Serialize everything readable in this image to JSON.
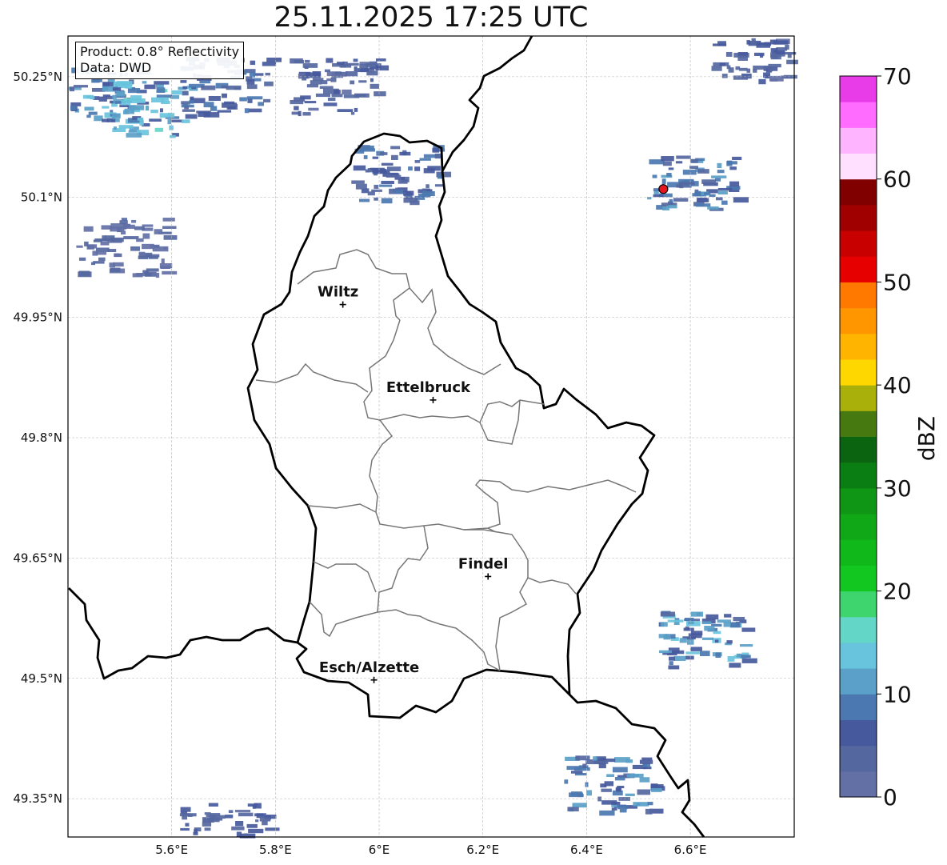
{
  "title": "25.11.2025 17:25 UTC",
  "info": {
    "product": "Product: 0.8° Reflectivity",
    "data": "Data: DWD"
  },
  "axes": {
    "lon_range": [
      5.4,
      6.8
    ],
    "lat_range": [
      49.3,
      50.3
    ],
    "x_ticks": [
      {
        "lon": 5.6,
        "label": "5.6°E"
      },
      {
        "lon": 5.8,
        "label": "5.8°E"
      },
      {
        "lon": 6.0,
        "label": "6°E"
      },
      {
        "lon": 6.2,
        "label": "6.2°E"
      },
      {
        "lon": 6.4,
        "label": "6.4°E"
      },
      {
        "lon": 6.6,
        "label": "6.6°E"
      }
    ],
    "y_ticks": [
      {
        "lat": 50.25,
        "label": "50.25°N"
      },
      {
        "lat": 50.1,
        "label": "50.1°N"
      },
      {
        "lat": 49.95,
        "label": "49.95°N"
      },
      {
        "lat": 49.8,
        "label": "49.8°N"
      },
      {
        "lat": 49.65,
        "label": "49.65°N"
      },
      {
        "lat": 49.5,
        "label": "49.5°N"
      },
      {
        "lat": 49.35,
        "label": "49.35°N"
      }
    ],
    "grid": true
  },
  "cities": [
    {
      "name": "Wiltz",
      "lon": 5.93,
      "lat": 49.966
    },
    {
      "name": "Ettelbruck",
      "lon": 6.104,
      "lat": 49.847
    },
    {
      "name": "Findel",
      "lon": 6.21,
      "lat": 49.627
    },
    {
      "name": "Esch/Alzette",
      "lon": 5.99,
      "lat": 49.498
    }
  ],
  "radar_site": {
    "lon": 6.548,
    "lat": 50.11,
    "color": "#e8141e"
  },
  "colorbar": {
    "label": "dBZ",
    "min": 0,
    "max": 70,
    "step": 2.5,
    "ticks": [
      {
        "value": 0,
        "label": "0"
      },
      {
        "value": 10,
        "label": "10"
      },
      {
        "value": 20,
        "label": "20"
      },
      {
        "value": 30,
        "label": "30"
      },
      {
        "value": 40,
        "label": "40"
      },
      {
        "value": 50,
        "label": "50"
      },
      {
        "value": 60,
        "label": "60"
      },
      {
        "value": 70,
        "label": "70"
      }
    ],
    "colors": [
      "#6370a6",
      "#55679f",
      "#46599d",
      "#4b78b0",
      "#5aa0c8",
      "#68c3dc",
      "#64d6c8",
      "#3ed46e",
      "#12c820",
      "#11b81a",
      "#11a818",
      "#0e9614",
      "#0a7e12",
      "#0a6410",
      "#467a10",
      "#aab00a",
      "#ffd700",
      "#ffb400",
      "#ff9600",
      "#ff7800",
      "#e60000",
      "#c80000",
      "#a00000",
      "#800000",
      "#ffe0ff",
      "#ffb4ff",
      "#ff6cff",
      "#e83ce8"
    ]
  },
  "echoes": [
    {
      "lon": 5.45,
      "lat": 50.23,
      "intensity": 12
    },
    {
      "lon": 5.55,
      "lat": 50.21,
      "intensity": 14
    },
    {
      "lon": 5.7,
      "lat": 50.24,
      "intensity": 8
    },
    {
      "lon": 5.91,
      "lat": 50.24,
      "intensity": 6
    },
    {
      "lon": 6.03,
      "lat": 50.13,
      "intensity": 8
    },
    {
      "lon": 5.5,
      "lat": 50.04,
      "intensity": 4
    },
    {
      "lon": 6.6,
      "lat": 50.12,
      "intensity": 10
    },
    {
      "lon": 6.72,
      "lat": 50.28,
      "intensity": 6
    },
    {
      "lon": 6.62,
      "lat": 49.55,
      "intensity": 12
    },
    {
      "lon": 6.44,
      "lat": 49.37,
      "intensity": 10
    },
    {
      "lon": 5.7,
      "lat": 49.31,
      "intensity": 6
    }
  ]
}
